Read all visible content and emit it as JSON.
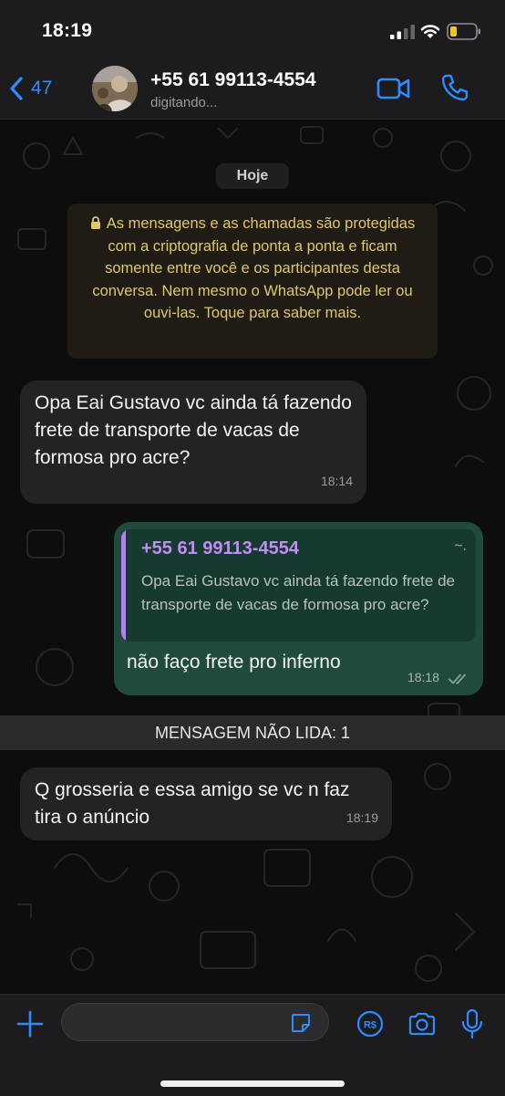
{
  "status_bar": {
    "time": "18:19"
  },
  "header": {
    "back_count": "47",
    "contact_name": "+55 61 99113-4554",
    "contact_status": "digitando..."
  },
  "chat": {
    "date_label": "Hoje",
    "encryption_notice": "As mensagens e as chamadas são protegidas com a criptografia de ponta a ponta e ficam somente entre você e os participantes desta conversa. Nem mesmo o WhatsApp pode ler ou ouvi-las. Toque para saber mais.",
    "messages": [
      {
        "direction": "incoming",
        "text": "Opa Eai Gustavo vc ainda tá fazendo frete de transporte de vacas de formosa pro acre?",
        "time": "18:14"
      },
      {
        "direction": "outgoing",
        "quoted_author": "+55 61 99113-4554",
        "quoted_marker": "~.",
        "quoted_text": "Opa Eai Gustavo vc ainda tá fazendo frete de transporte de vacas de formosa pro acre?",
        "text": "não faço frete pro inferno",
        "time": "18:18",
        "status": "read"
      },
      {
        "direction": "incoming",
        "text": "Q grosseria e essa amigo se vc n faz tira o anúncio",
        "time": "18:19"
      }
    ],
    "unread_banner": "MENSAGEM NÃO LIDA: 1"
  },
  "input_bar": {
    "placeholder": "",
    "pay_label": "R$"
  },
  "colors": {
    "accent": "#2f8cff",
    "outgoing_bubble": "#1f4a3d",
    "incoming_bubble": "#232323",
    "quote_author": "#c28cf7",
    "notice_text": "#e0c866"
  }
}
